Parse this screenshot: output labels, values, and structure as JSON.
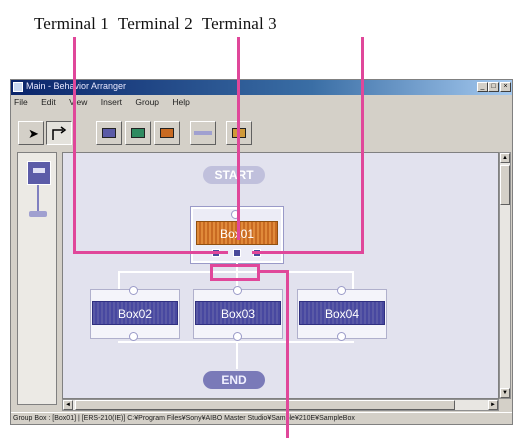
{
  "caption": {
    "terminal1": "Terminal 1",
    "terminal2": "Terminal 2",
    "terminal3": "Terminal 3"
  },
  "window": {
    "title": "Main - Behavior Arranger",
    "controls": [
      "_",
      "□",
      "×"
    ]
  },
  "menu": [
    "File",
    "Edit",
    "View",
    "Insert",
    "Group",
    "Help"
  ],
  "toolbar": {
    "tools": [
      "select-arrow-icon",
      "connect-tool-icon",
      "box-tool-1-icon",
      "box-tool-2-icon",
      "box-tool-3-icon",
      "line-tool-icon",
      "box-tool-4-icon"
    ],
    "selected_tool": "connect-tool-icon"
  },
  "flow": {
    "start_label": "START",
    "end_label": "END",
    "boxes": [
      "Box01",
      "Box02",
      "Box03",
      "Box04"
    ],
    "selected_box": "Box01"
  },
  "scroll": {
    "up": "▲",
    "down": "▼",
    "left": "◄",
    "right": "►"
  },
  "status": {
    "text": "Group Box : [Box01] | [ERS-210(IE)] C:¥Program Files¥Sony¥AIBO Master Studio¥Sample¥210E¥SampleBox"
  },
  "colors": {
    "callout": "#e0479a",
    "box_purple": "#4848a0",
    "box_orange": "#c86a22",
    "titlebar": "#0a246a"
  }
}
